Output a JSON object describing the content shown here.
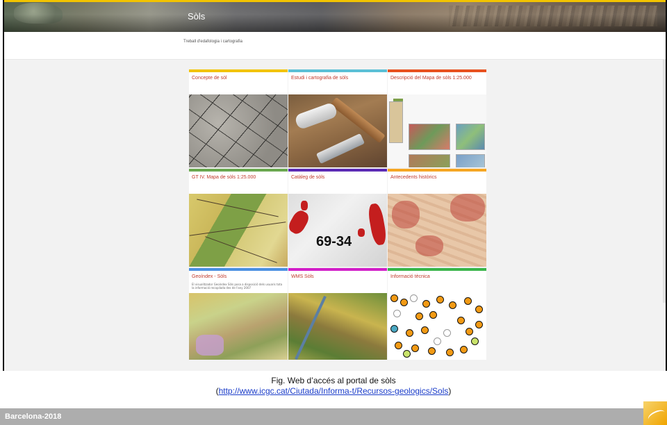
{
  "site": {
    "title": "Sòls",
    "breadcrumb": "Treball d'edafologia i cartografia"
  },
  "tiles": [
    {
      "title": "Concepte de sòl",
      "accent": "#f2c300",
      "thumb": "soil-cracks-photo"
    },
    {
      "title": "Estudi i cartografia de sòls",
      "accent": "#5bc0d6",
      "thumb": "field-tools-photo"
    },
    {
      "title": "Descripció del Mapa de sòls 1:25.000",
      "accent": "#e8511f",
      "thumb": "map-legend-image"
    },
    {
      "title": "GT IV. Mapa de sòls 1:25.000",
      "accent": "#6aa84f",
      "thumb": "geologic-map-image"
    },
    {
      "title": "Catàleg de sòls",
      "accent": "#5b2bb5",
      "thumb": "catalog-map-image",
      "overlay_number": "69-34"
    },
    {
      "title": "Antecedents històrics",
      "accent": "#f5a623",
      "thumb": "historic-map-image"
    },
    {
      "title": "Geoíndex - Sòls",
      "accent": "#4a90e2",
      "thumb": "geoindex-map-image",
      "description": "El visualitzador Geoíndex Sòls posa a disposició dels usuaris tota la informació recopilada des de l'any 2007"
    },
    {
      "title": "WMS Sòls",
      "accent": "#d21fc8",
      "thumb": "wms-map-image"
    },
    {
      "title": "Informació tècnica",
      "accent": "#39b54a",
      "thumb": "points-map-image"
    }
  ],
  "caption": {
    "line1": "Fig. Web d’accés al portal de sòls",
    "open_paren": "(",
    "url": "http://www.icgc.cat/Ciutada/Informa-t/Recursos-geologics/Sols",
    "close_paren": ")"
  },
  "footer": {
    "text": "Barcelona-2018",
    "bg_color": "#adadad",
    "logo_color": "#f0a400"
  }
}
